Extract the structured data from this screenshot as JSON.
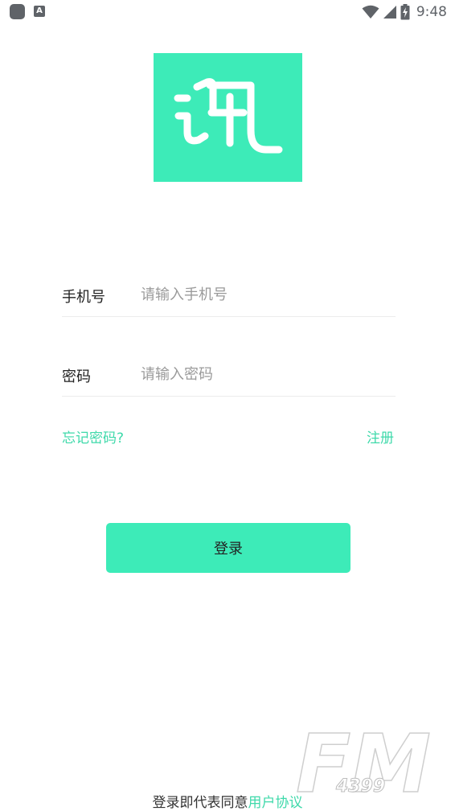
{
  "status_bar": {
    "time": "9:48",
    "icons": [
      "app-notification-icon",
      "a-notification-icon",
      "wifi-icon",
      "signal-icon",
      "battery-charging-icon"
    ]
  },
  "logo": {
    "text": "讯",
    "background_color": "#3debb8"
  },
  "form": {
    "phone": {
      "label": "手机号",
      "placeholder": "请输入手机号",
      "value": ""
    },
    "password": {
      "label": "密码",
      "placeholder": "请输入密码",
      "value": ""
    },
    "forgot_password": "忘记密码?",
    "register": "注册",
    "login_button": "登录"
  },
  "agreement": {
    "prefix": "登录即代表同意",
    "link": "用户协议"
  },
  "watermark": {
    "text_main": "FM",
    "text_sub": "4399"
  },
  "colors": {
    "accent": "#3debb8",
    "link": "#3ed9aa",
    "text": "#222222",
    "placeholder": "#9a9a9a",
    "divider": "#ececec"
  }
}
